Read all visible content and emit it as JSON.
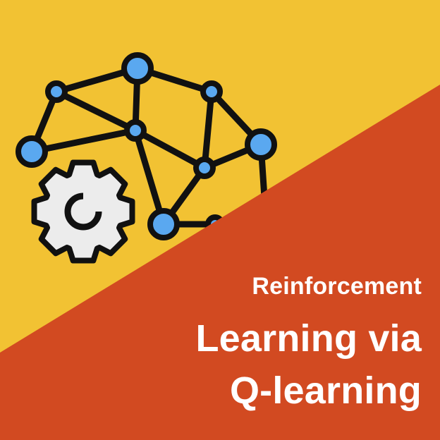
{
  "colors": {
    "background_top": "#F2C233",
    "background_bottom": "#D24A21",
    "node_fill": "#5AA8F0",
    "gear_fill": "#ECECEC",
    "stroke": "#111111",
    "title_text": "#FFFFFF"
  },
  "icons": {
    "brain": "network-brain-icon",
    "gear": "gear-icon"
  },
  "title": {
    "line1": "Reinforcement",
    "line2": "Learning via",
    "line3": "Q-learning"
  }
}
